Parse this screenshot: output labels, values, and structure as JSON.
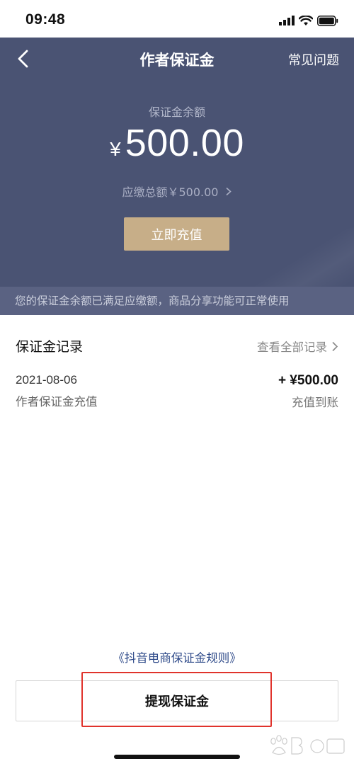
{
  "status_bar": {
    "time": "09:48"
  },
  "header": {
    "title": "作者保证金",
    "faq_label": "常见问题",
    "balance_label": "保证金余额",
    "currency_symbol": "¥",
    "balance_value": "500.00",
    "due_text": "应缴总额￥500.00",
    "recharge_label": "立即充值",
    "notice": "您的保证金余额已满足应缴额，商品分享功能可正常使用"
  },
  "records": {
    "title": "保证金记录",
    "view_all_label": "查看全部记录",
    "items": [
      {
        "date": "2021-08-06",
        "description": "作者保证金充值",
        "amount": "+ ¥500.00",
        "status": "充值到账"
      }
    ]
  },
  "footer": {
    "rules_link": "《抖音电商保证金规则》",
    "withdraw_label": "提现保证金"
  },
  "colors": {
    "header_bg": "#4a5373",
    "recharge_button": "#c7ae88",
    "rules_link": "#2f4b8a",
    "highlight": "#e0332c"
  }
}
